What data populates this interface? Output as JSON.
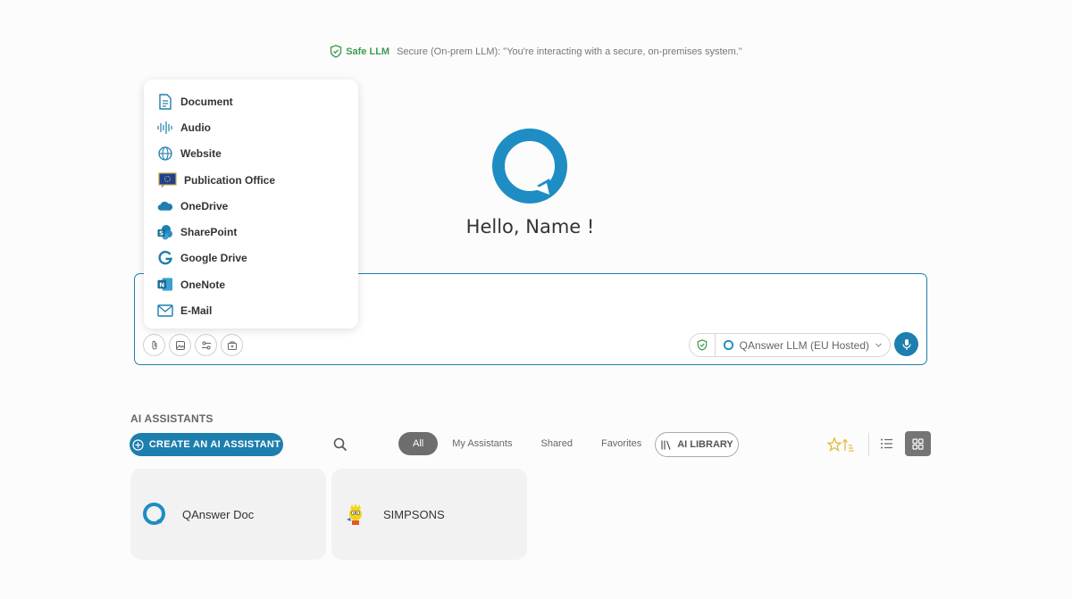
{
  "banner": {
    "badge": "Safe LLM",
    "text": "Secure (On-prem LLM): \"You're interacting with a secure, on-premises system.\""
  },
  "greeting": "Hello, Name !",
  "attach_menu": {
    "items": [
      {
        "label": "Document",
        "icon": "document-icon"
      },
      {
        "label": "Audio",
        "icon": "audio-icon"
      },
      {
        "label": "Website",
        "icon": "globe-icon"
      },
      {
        "label": "Publication Office",
        "icon": "publication-office-icon"
      },
      {
        "label": "OneDrive",
        "icon": "onedrive-icon"
      },
      {
        "label": "SharePoint",
        "icon": "sharepoint-icon"
      },
      {
        "label": "Google Drive",
        "icon": "google-drive-icon"
      },
      {
        "label": "OneNote",
        "icon": "onenote-icon"
      },
      {
        "label": "E-Mail",
        "icon": "email-icon"
      }
    ]
  },
  "chat": {
    "model_label": "QAnswer LLM (EU Hosted)"
  },
  "assistants": {
    "section_title": "AI ASSISTANTS",
    "create_label": "CREATE AN AI ASSISTANT",
    "tabs": [
      "All",
      "My Assistants",
      "Shared",
      "Favorites"
    ],
    "active_tab": "All",
    "library_label": "AI LIBRARY",
    "cards": [
      {
        "name": "QAnswer Doc",
        "icon": "qanswer-logo-icon"
      },
      {
        "name": "SIMPSONS",
        "icon": "simpsons-avatar-icon"
      }
    ]
  },
  "colors": {
    "accent": "#1d7fae",
    "safe_green": "#3d9b4e",
    "star_gold": "#e2b93b"
  }
}
